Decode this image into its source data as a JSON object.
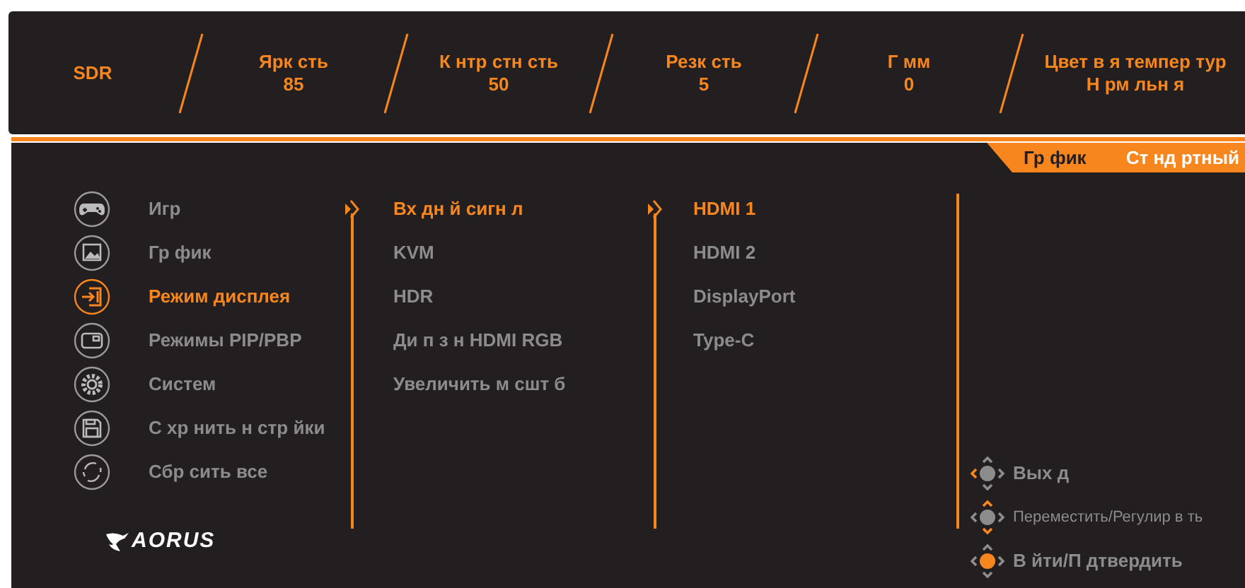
{
  "header": [
    {
      "title": "SDR"
    },
    {
      "title": "Ярк сть",
      "value": "85"
    },
    {
      "title": "К нтр стн сть",
      "value": "50"
    },
    {
      "title": "Резк сть",
      "value": "5"
    },
    {
      "title": "Г мм",
      "value": "0"
    },
    {
      "title": "Цвет в я темпер тур",
      "value": "Н рм льн я"
    }
  ],
  "mode_tab": {
    "label": "Гр фик",
    "value": "Ст нд ртный"
  },
  "menu": [
    {
      "label": "Игр",
      "kind": "gamepad",
      "selected": false
    },
    {
      "label": "Гр фик",
      "kind": "picture",
      "selected": false
    },
    {
      "label": "Режим дисплея",
      "kind": "input",
      "selected": true
    },
    {
      "label": "Режимы PIP/PBP",
      "kind": "pip",
      "selected": false
    },
    {
      "label": "Систем",
      "kind": "gear",
      "selected": false
    },
    {
      "label": "С хр нить н стр йки",
      "kind": "save",
      "selected": false
    },
    {
      "label": "Сбр сить все",
      "kind": "reset",
      "selected": false
    }
  ],
  "submenu": [
    {
      "label": "Вх дн й сигн л",
      "selected": true
    },
    {
      "label": "KVM",
      "selected": false
    },
    {
      "label": "HDR",
      "selected": false
    },
    {
      "label": "Ди п з н HDMI RGB",
      "selected": false
    },
    {
      "label": "Увеличить м сшт б",
      "selected": false
    }
  ],
  "sources": [
    {
      "label": "HDMI 1",
      "selected": true
    },
    {
      "label": "HDMI 2",
      "selected": false
    },
    {
      "label": "DisplayPort",
      "selected": false
    },
    {
      "label": "Type-C",
      "selected": false
    }
  ],
  "logo": "AORUS",
  "hints": [
    {
      "kind": "exit",
      "label": "Вых д"
    },
    {
      "kind": "move",
      "label": "Переместить/Регулир в ть"
    },
    {
      "kind": "enter",
      "label": "В йти/П дтвердить"
    }
  ]
}
